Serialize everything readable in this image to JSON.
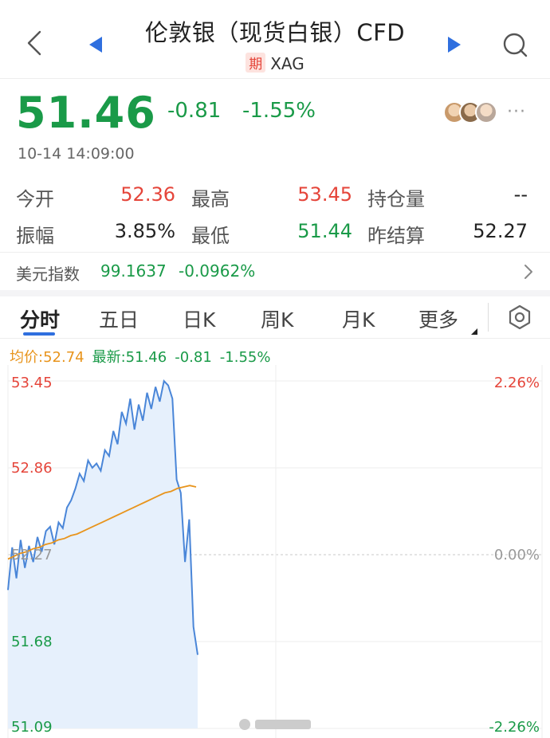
{
  "header": {
    "title": "伦敦银（现货白银）CFD",
    "badge": "期",
    "symbol": "XAG"
  },
  "quote": {
    "price": "51.46",
    "change": "-0.81",
    "change_pct": "-1.55%",
    "time": "10-14 14:09:00",
    "more_label": "···"
  },
  "stats": {
    "open_label": "今开",
    "open_value": "52.36",
    "high_label": "最高",
    "high_value": "53.45",
    "oi_label": "持仓量",
    "oi_value": "--",
    "amp_label": "振幅",
    "amp_value": "3.85%",
    "low_label": "最低",
    "low_value": "51.44",
    "settle_label": "昨结算",
    "settle_value": "52.27"
  },
  "usd_index": {
    "label": "美元指数",
    "value": "99.1637",
    "change_pct": "-0.0962%"
  },
  "tabs": [
    "分时",
    "五日",
    "日K",
    "周K",
    "月K",
    "更多"
  ],
  "active_tab": "分时",
  "chart_info": {
    "avg": "均价:52.74",
    "last": "最新:51.46",
    "change": "-0.81",
    "change_pct": "-1.55%"
  },
  "colors": {
    "up": "#e5453a",
    "down": "#1a9a48",
    "price_line": "#4a86d8",
    "avg_line": "#e8941c",
    "accent": "#2f6fdf"
  },
  "chart_data": {
    "type": "line",
    "y_left_ticks": [
      "53.45",
      "52.86",
      "52.27",
      "51.68",
      "51.09"
    ],
    "y_right_ticks": [
      "2.26%",
      "0.00%",
      "-2.26%"
    ],
    "ylim": [
      51.09,
      53.45
    ],
    "baseline": 52.27,
    "series": [
      {
        "key": "price",
        "values": [
          52.03,
          52.32,
          52.11,
          52.37,
          52.18,
          52.33,
          52.22,
          52.39,
          52.29,
          52.43,
          52.46,
          52.34,
          52.49,
          52.45,
          52.59,
          52.64,
          52.72,
          52.82,
          52.77,
          52.91,
          52.86,
          52.89,
          52.84,
          52.98,
          52.94,
          53.11,
          53.02,
          53.24,
          53.16,
          53.33,
          53.12,
          53.29,
          53.18,
          53.37,
          53.26,
          53.41,
          53.31,
          53.45,
          53.42,
          53.33,
          52.78,
          52.69,
          52.22,
          52.51,
          51.78,
          51.59
        ]
      },
      {
        "key": "average",
        "values": [
          52.24,
          52.26,
          52.28,
          52.29,
          52.31,
          52.32,
          52.34,
          52.35,
          52.37,
          52.38,
          52.4,
          52.41,
          52.43,
          52.45,
          52.47,
          52.49,
          52.51,
          52.53,
          52.55,
          52.57,
          52.59,
          52.61,
          52.63,
          52.65,
          52.67,
          52.69,
          52.7,
          52.72,
          52.73,
          52.74,
          52.73
        ]
      }
    ],
    "grid": true
  }
}
